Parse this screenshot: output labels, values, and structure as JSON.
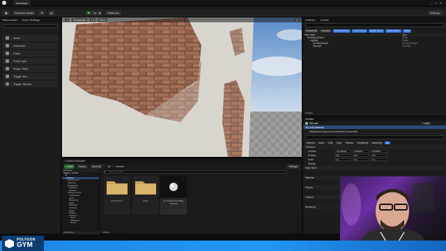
{
  "window": {
    "tab_title": "NewMap*",
    "settings_label": "Settings"
  },
  "toolbar": {
    "selection_mode": "Selection Mode",
    "platforms": "Platforms"
  },
  "place_actors": {
    "tabs": [
      "Place Actors",
      "World Settings"
    ],
    "items": [
      "Actor",
      "Character",
      "Pawn",
      "Point Light",
      "Player Start",
      "Trigger Box",
      "Trigger Sphere"
    ]
  },
  "viewport": {
    "chips": [
      "Perspective",
      "Lit",
      "Show"
    ],
    "speed": "3"
  },
  "content_browser": {
    "tab": "Content Browser",
    "add_label": "+ Add",
    "import_label": "Import",
    "save_all_label": "Save All",
    "path": [
      "All",
      "Content"
    ],
    "settings_label": "Settings",
    "search_placeholder": "Search Content",
    "favorites_label": "Favorites",
    "collections_label": "Collections",
    "tree": [
      "Shader_Tutorial",
      "All",
      "Content",
      "Environment",
      "Materials",
      "Megascans",
      "Surfaces",
      "Meshes",
      "StarterContent",
      "Architecture",
      "Audio",
      "Blueprints",
      "Maps",
      "Materials",
      "Particles",
      "Props",
      "Shapes",
      "Textures",
      "Brick",
      "Wallpaper",
      "Wood"
    ],
    "assets": [
      {
        "label": "Environment",
        "kind": "folder"
      },
      {
        "label": "Maps",
        "kind": "folder"
      },
      {
        "label": "M_ShaderTutorialMat Material",
        "kind": "material"
      }
    ],
    "item_count": "3 items"
  },
  "outliner": {
    "tabs": [
      "Outliner",
      "Levels"
    ],
    "filters": [
      "Unsaved All",
      "Unloaded",
      "Selected Actors",
      "Current Level",
      "Hidden Actors",
      "Static Meshes",
      "Lights"
    ],
    "header": [
      "Item Label",
      "Type"
    ],
    "rows": [
      {
        "label": "NewMap (Editor)",
        "type": "World"
      },
      {
        "label": "Lighting",
        "type": "Folder"
      },
      {
        "label": "DirectionalLight",
        "type": "DirectionalLight"
      },
      {
        "label": "SkyLight",
        "type": "SkyLight"
      }
    ],
    "actor_count": "5 actors"
  },
  "details": {
    "tab": "Details",
    "object_name": "SM_wall",
    "add_label": "+ Add",
    "instance_label": "SM_wall (Instance)",
    "component_label": "StaticMeshComponent (StaticMeshComponent0)",
    "categories": [
      "General",
      "Actor",
      "LOD",
      "Misc",
      "Physics",
      "Rendering",
      "Streaming",
      "All"
    ],
    "sections": [
      "Transform",
      "Static Mesh",
      "Materials",
      "Physics",
      "Collision",
      "Rendering"
    ],
    "transform": [
      {
        "label": "Location",
        "x": "-76.424240",
        "y": "1.882003",
        "z": "3.000007"
      },
      {
        "label": "Rotation",
        "x": "0.0°",
        "y": "0.0°",
        "z": "0.0°"
      },
      {
        "label": "Scale",
        "x": "1.0",
        "y": "1.0",
        "z": "1.0"
      }
    ],
    "mobility_label": "Mobility"
  },
  "brand": {
    "line1": "POLYGON",
    "line2": "GYM"
  },
  "colors": {
    "accent_blue": "#1e88e5",
    "outliner_filter": "#2f6fd6",
    "selected_row": "#2a4a7a"
  }
}
